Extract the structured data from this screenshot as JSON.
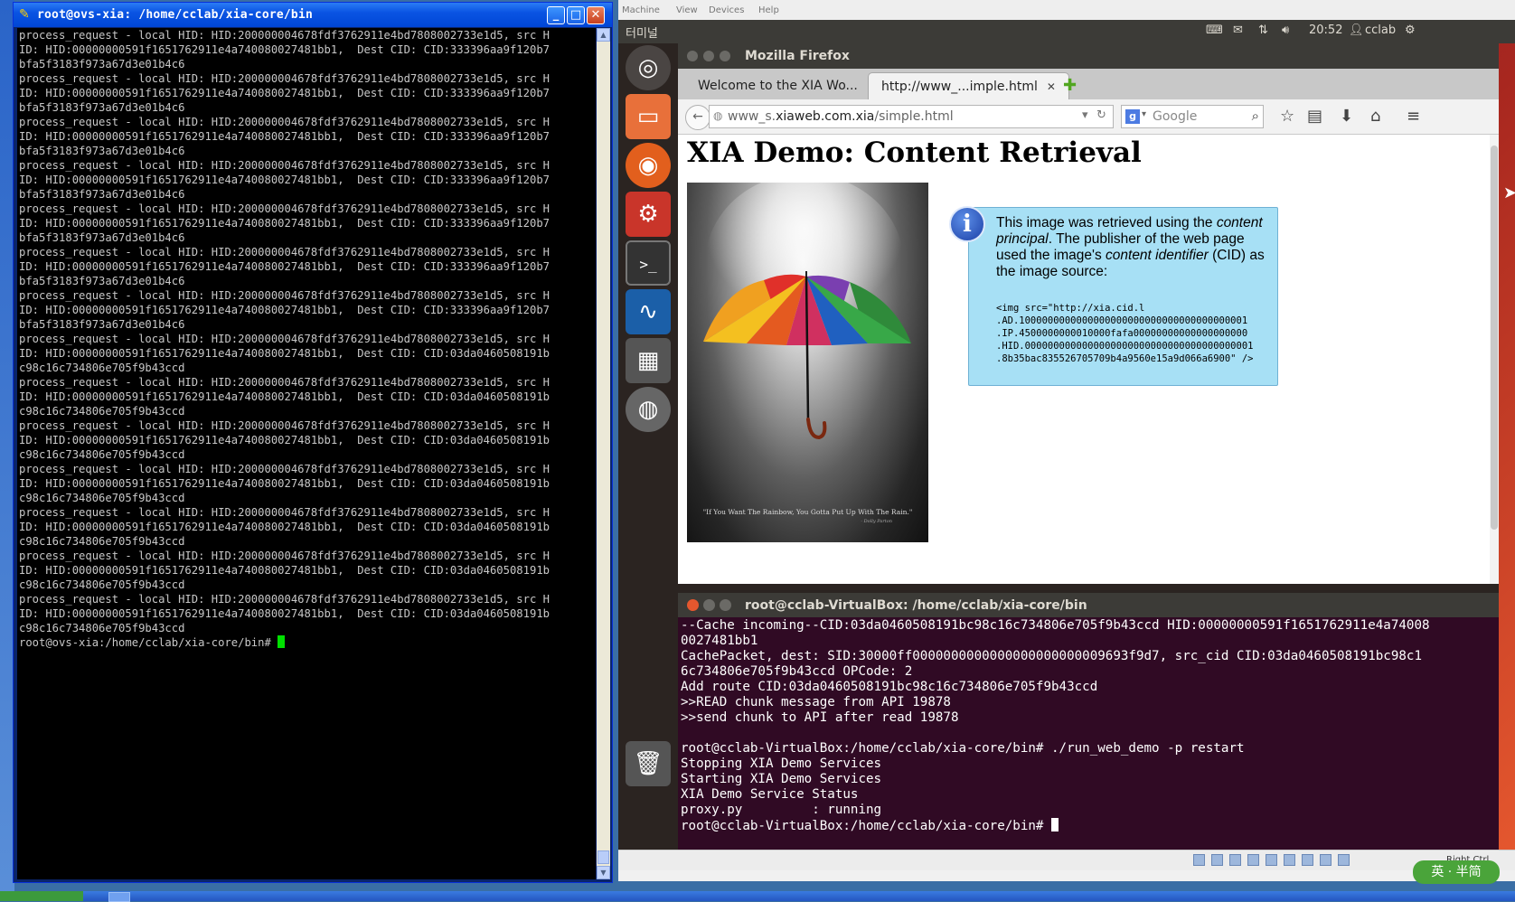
{
  "putty": {
    "title": "root@ovs-xia: /home/cclab/xia-core/bin",
    "lines": [
      "process_request - local HID: HID:200000004678fdf3762911e4bd7808002733e1d5, src H",
      "ID: HID:00000000591f1651762911e4a740080027481bb1,  Dest CID: CID:333396aa9f120b7",
      "bfa5f3183f973a67d3e01b4c6",
      "process_request - local HID: HID:200000004678fdf3762911e4bd7808002733e1d5, src H",
      "ID: HID:00000000591f1651762911e4a740080027481bb1,  Dest CID: CID:333396aa9f120b7",
      "bfa5f3183f973a67d3e01b4c6",
      "process_request - local HID: HID:200000004678fdf3762911e4bd7808002733e1d5, src H",
      "ID: HID:00000000591f1651762911e4a740080027481bb1,  Dest CID: CID:333396aa9f120b7",
      "bfa5f3183f973a67d3e01b4c6",
      "process_request - local HID: HID:200000004678fdf3762911e4bd7808002733e1d5, src H",
      "ID: HID:00000000591f1651762911e4a740080027481bb1,  Dest CID: CID:333396aa9f120b7",
      "bfa5f3183f973a67d3e01b4c6",
      "process_request - local HID: HID:200000004678fdf3762911e4bd7808002733e1d5, src H",
      "ID: HID:00000000591f1651762911e4a740080027481bb1,  Dest CID: CID:333396aa9f120b7",
      "bfa5f3183f973a67d3e01b4c6",
      "process_request - local HID: HID:200000004678fdf3762911e4bd7808002733e1d5, src H",
      "ID: HID:00000000591f1651762911e4a740080027481bb1,  Dest CID: CID:333396aa9f120b7",
      "bfa5f3183f973a67d3e01b4c6",
      "process_request - local HID: HID:200000004678fdf3762911e4bd7808002733e1d5, src H",
      "ID: HID:00000000591f1651762911e4a740080027481bb1,  Dest CID: CID:333396aa9f120b7",
      "bfa5f3183f973a67d3e01b4c6",
      "process_request - local HID: HID:200000004678fdf3762911e4bd7808002733e1d5, src H",
      "ID: HID:00000000591f1651762911e4a740080027481bb1,  Dest CID: CID:03da0460508191b",
      "c98c16c734806e705f9b43ccd",
      "process_request - local HID: HID:200000004678fdf3762911e4bd7808002733e1d5, src H",
      "ID: HID:00000000591f1651762911e4a740080027481bb1,  Dest CID: CID:03da0460508191b",
      "c98c16c734806e705f9b43ccd",
      "process_request - local HID: HID:200000004678fdf3762911e4bd7808002733e1d5, src H",
      "ID: HID:00000000591f1651762911e4a740080027481bb1,  Dest CID: CID:03da0460508191b",
      "c98c16c734806e705f9b43ccd",
      "process_request - local HID: HID:200000004678fdf3762911e4bd7808002733e1d5, src H",
      "ID: HID:00000000591f1651762911e4a740080027481bb1,  Dest CID: CID:03da0460508191b",
      "c98c16c734806e705f9b43ccd",
      "process_request - local HID: HID:200000004678fdf3762911e4bd7808002733e1d5, src H",
      "ID: HID:00000000591f1651762911e4a740080027481bb1,  Dest CID: CID:03da0460508191b",
      "c98c16c734806e705f9b43ccd",
      "process_request - local HID: HID:200000004678fdf3762911e4bd7808002733e1d5, src H",
      "ID: HID:00000000591f1651762911e4a740080027481bb1,  Dest CID: CID:03da0460508191b",
      "c98c16c734806e705f9b43ccd",
      "process_request - local HID: HID:200000004678fdf3762911e4bd7808002733e1d5, src H",
      "ID: HID:00000000591f1651762911e4a740080027481bb1,  Dest CID: CID:03da0460508191b",
      "c98c16c734806e705f9b43ccd"
    ],
    "prompt": "root@ovs-xia:/home/cclab/xia-core/bin# "
  },
  "vbox_menu": [
    "Machine",
    "View",
    "Devices",
    "Help"
  ],
  "ubuntu": {
    "panel_app": "터미널",
    "clock": "20:52",
    "user": "cclab"
  },
  "firefox": {
    "window_title": "Mozilla Firefox",
    "tabs": [
      {
        "label": "Welcome to the XIA Wo..."
      },
      {
        "label": "http://www_...imple.html"
      }
    ],
    "url_prefix": "www_s.",
    "url_domain": "xiaweb.com.xia",
    "url_path": "/simple.html",
    "search_placeholder": "Google",
    "page": {
      "heading": "XIA Demo: Content Retrieval",
      "poster_quote": "\"If You Want The Rainbow, You Gotta Put Up With The Rain.\"",
      "poster_author": "- Dolly Parton",
      "info_pre1": "This image was retrieved using the ",
      "info_em1": "content principal",
      "info_mid": ". The publisher of the web page used the image's ",
      "info_em2": "content identifier",
      "info_post": " (CID) as the image source:",
      "code": "<img src=\"http://xia.cid.l\n.AD.1000000000000000000000000000000000000001\n.IP.4500000000010000fafa00000000000000000000\n.HID.0000000000000000000000000000000000000001\n.8b35bac835526705709b4a9560e15a9d066a6900\" />"
    }
  },
  "terminal": {
    "title": "root@cclab-VirtualBox: /home/cclab/xia-core/bin",
    "lines": [
      "--Cache incoming--CID:03da0460508191bc98c16c734806e705f9b43ccd HID:00000000591f1651762911e4a74008",
      "0027481bb1",
      "CachePacket, dest: SID:30000ff0000000000000000000000009693f9d7, src_cid CID:03da0460508191bc98c1",
      "6c734806e705f9b43ccd OPCode: 2",
      "Add route CID:03da0460508191bc98c16c734806e705f9b43ccd",
      ">>READ chunk message from API 19878",
      ">>send chunk to API after read 19878",
      "",
      "root@cclab-VirtualBox:/home/cclab/xia-core/bin# ./run_web_demo -p restart",
      "Stopping XIA Demo Services",
      "Starting XIA Demo Services",
      "XIA Demo Service Status",
      "proxy.py         : running"
    ],
    "prompt": "root@cclab-VirtualBox:/home/cclab/xia-core/bin# "
  },
  "vbox_status": {
    "hostkey": "Right Ctrl"
  },
  "ime": {
    "label": "英 · 半简"
  },
  "colors": {
    "ubuntu_terminal_bg": "#300a24",
    "putty_bg": "#000000",
    "info_box_bg": "#a7e0f5",
    "xp_title_blue": "#0a54e3"
  }
}
